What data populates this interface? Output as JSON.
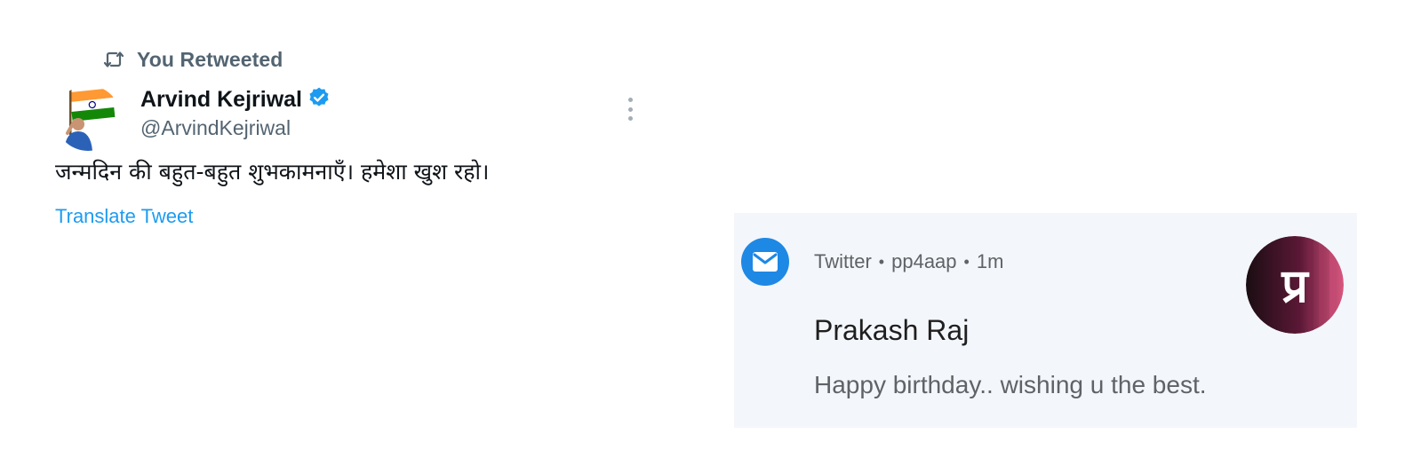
{
  "tweet": {
    "retweet_label": "You Retweeted",
    "author_name": "Arvind Kejriwal",
    "author_handle": "@ArvindKejriwal",
    "verified": true,
    "text": "जन्मदिन की बहुत-बहुत शुभकामनाएँ। हमेशा खुश रहो।",
    "translate_label": "Translate Tweet",
    "colors": {
      "link": "#1d9bf0",
      "verified_badge": "#1d9bf0",
      "muted_text": "#536471"
    },
    "icons": {
      "retweet": "retweet-icon",
      "verified": "verified-badge-icon",
      "more": "more-vertical-icon"
    }
  },
  "notification": {
    "app_name": "Twitter",
    "separator": "•",
    "account": "pp4aap",
    "time": "1m",
    "title": "Prakash Raj",
    "body": "Happy birthday.. wishing u the best.",
    "avatar_text": "प्र",
    "colors": {
      "card_background": "#f3f6fa",
      "app_icon": "#1e88e5"
    },
    "icons": {
      "app": "mail-icon"
    }
  }
}
